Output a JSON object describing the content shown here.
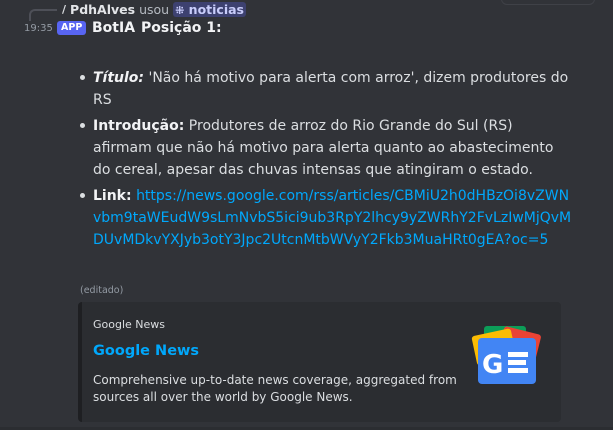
{
  "reply": {
    "user": "PdhAlves",
    "action": "usou",
    "command": "noticias"
  },
  "message": {
    "time": "19:35",
    "badge": "APP",
    "author": "BotIA",
    "heading": "Posição 1:",
    "titulo_label": "Título:",
    "titulo_text": "'Não há motivo para alerta com arroz', dizem produtores do RS",
    "intro_label": "Introdução:",
    "intro_text": "Produtores de arroz do Rio Grande do Sul (RS) afirmam que não há motivo para alerta quanto ao abastecimento do cereal, apesar das chuvas intensas que atingiram o estado.",
    "link_label": "Link:",
    "link_url": "https://news.google.com/rss/articles/CBMiU2h0dHBzOi8vZWNvbm9taWEudW9sLmNvbS5ici9ub3RpY2lhcy9yZWRhY2FvLzIwMjQvMDUvMDkvYXJyb3otY3Jpc2UtcnMtbWVyY2Fkb3MuaHRt0gEA?oc=5",
    "edited": "(editado)"
  },
  "embed": {
    "provider": "Google News",
    "title": "Google News",
    "description": "Comprehensive up-to-date news coverage, aggregated from sources all over the world by Google News.",
    "thumbnail_icon": "google-news-logo",
    "accent": "#1e1f22"
  },
  "colors": {
    "background": "#313338",
    "link": "#00a8fc",
    "app_badge": "#5865f2"
  }
}
